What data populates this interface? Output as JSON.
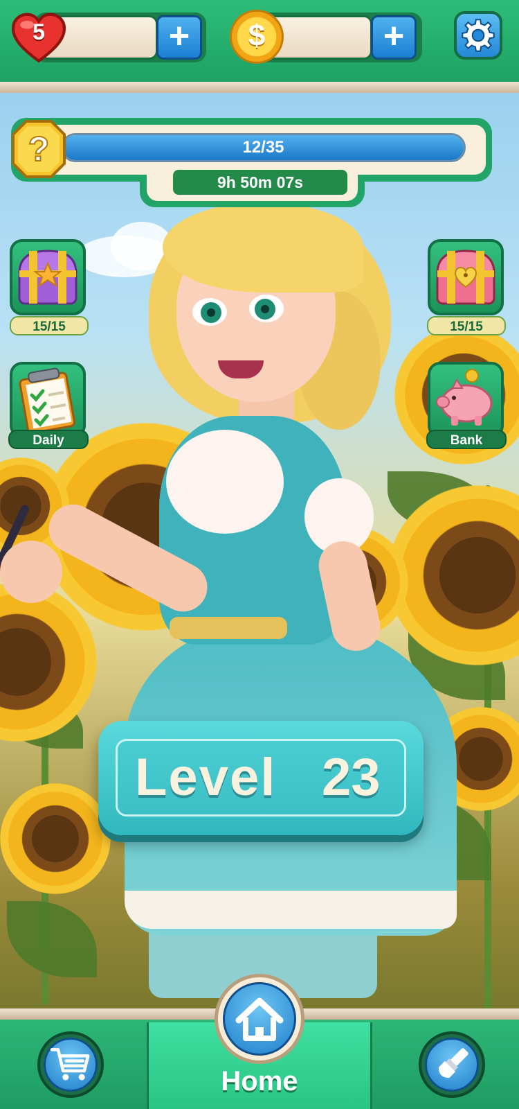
{
  "header": {
    "lives": "5",
    "lives_add": "+",
    "coins_add": "+",
    "coin_symbol": "$"
  },
  "quest": {
    "progress_text": "12/35",
    "progress_current": 12,
    "progress_total": 35,
    "timer": "9h 50m 07s",
    "badge_symbol": "?"
  },
  "side_left": [
    {
      "label": "15/15",
      "icon": "purple-treasure-chest-icon"
    },
    {
      "label": "Daily",
      "icon": "daily-checklist-icon"
    }
  ],
  "side_right": [
    {
      "label": "15/15",
      "icon": "pink-treasure-chest-icon"
    },
    {
      "label": "Bank",
      "icon": "piggy-bank-icon"
    }
  ],
  "level": {
    "word": "Level",
    "number": "23"
  },
  "bottom_nav": {
    "home_label": "Home",
    "icons": [
      "shopping-cart-icon",
      "home-icon",
      "paintbrush-icon"
    ]
  },
  "colors": {
    "green": "#22a468",
    "teal": "#3cc0c6",
    "blue": "#1b7fd3",
    "cream": "#f8f0dc"
  }
}
